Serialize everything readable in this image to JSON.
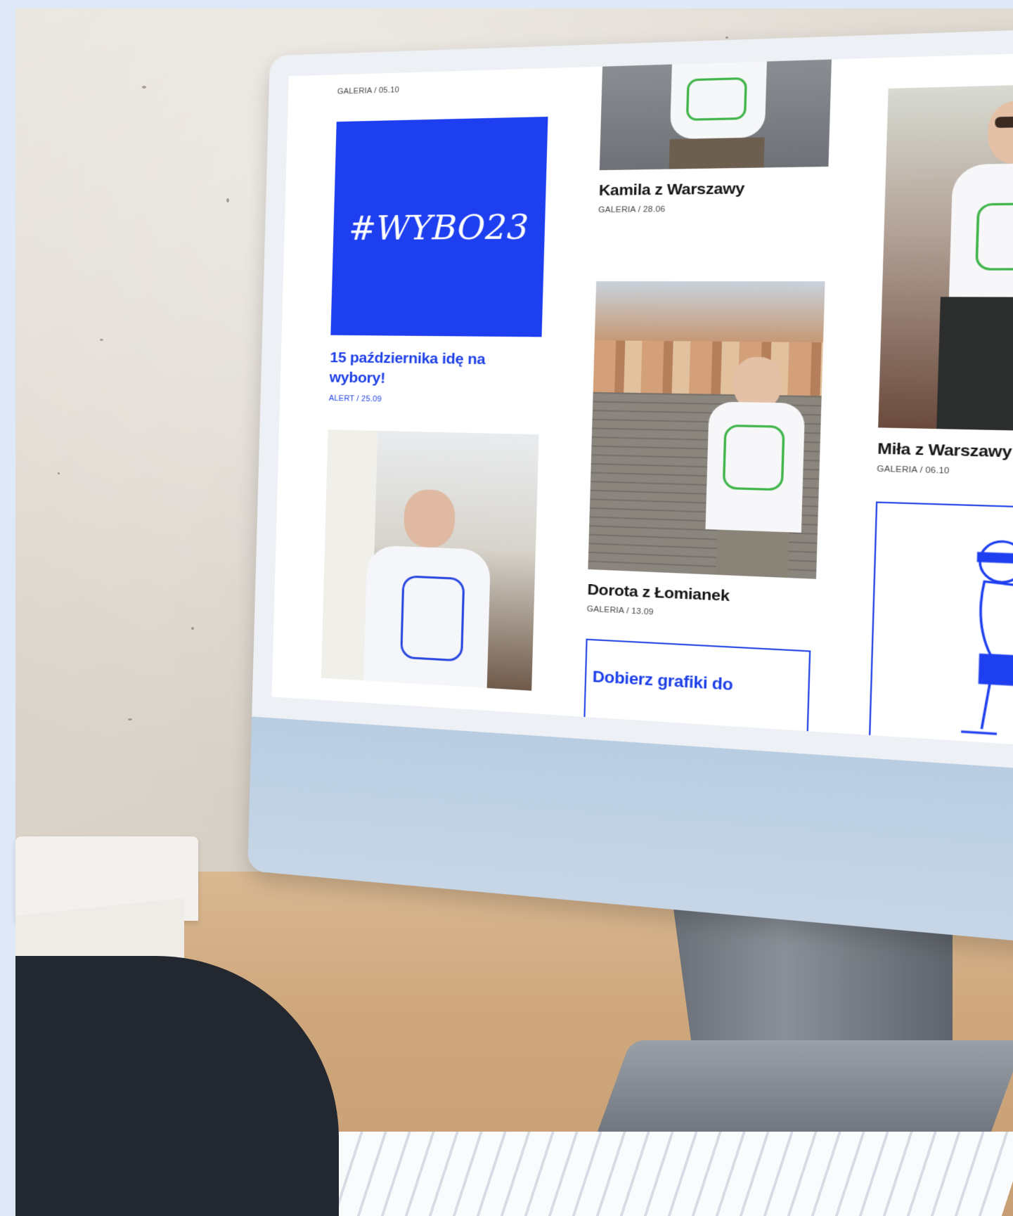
{
  "screen": {
    "partial_top_meta": "GALERIA / 05.10",
    "hashtag_tile": "#WYBO23",
    "alert_title": "15 października idę na wybory!",
    "alert_meta": "ALERT / 25.09",
    "card_kamila_title": "Kamila z Warszawy",
    "card_kamila_meta": "GALERIA / 28.06",
    "card_dorota_title": "Dorota z Łomianek",
    "card_dorota_meta": "GALERIA / 13.09",
    "partial_link_text": "Dobierz grafiki do",
    "card_mila_title": "Miła z Warszawy",
    "card_mila_meta": "GALERIA / 06.10"
  },
  "colors": {
    "accent_blue": "#1e3ff0",
    "shirt_green": "#3fb54a"
  }
}
